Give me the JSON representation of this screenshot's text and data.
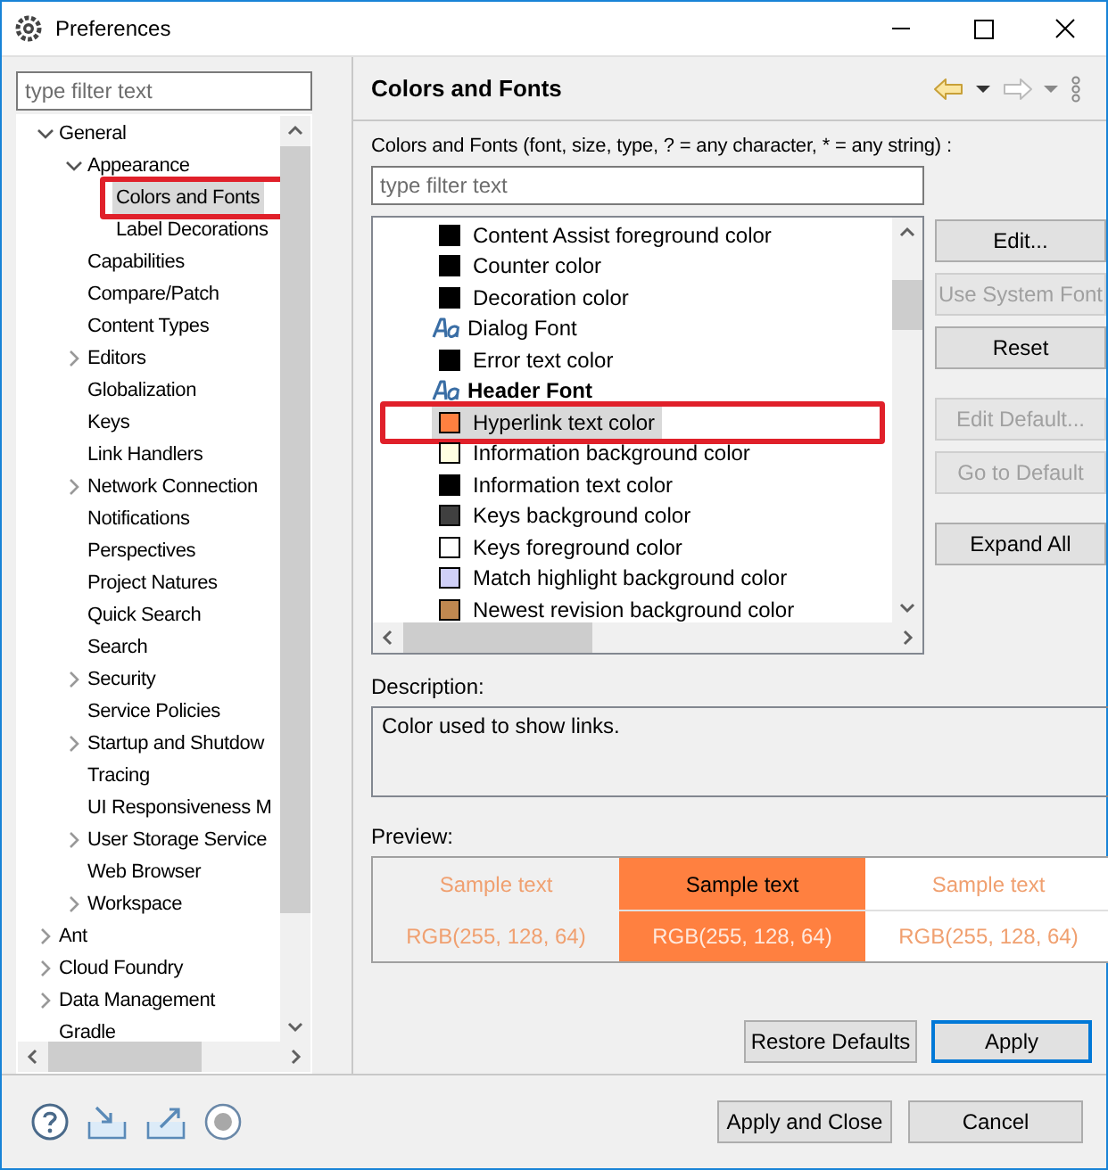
{
  "window": {
    "title": "Preferences"
  },
  "tree": {
    "placeholder": "type filter text",
    "items": [
      {
        "label": "General",
        "selected": false,
        "expanded": true,
        "children": [
          {
            "label": "Appearance",
            "selected": false,
            "expanded": true,
            "children": [
              {
                "label": "Colors and Fonts",
                "selected": true,
                "annotated": true
              },
              {
                "label": "Label Decorations",
                "selected": false
              }
            ]
          },
          {
            "label": "Capabilities",
            "selected": false
          },
          {
            "label": "Compare/Patch",
            "selected": false
          },
          {
            "label": "Content Types",
            "selected": false
          },
          {
            "label": "Editors",
            "selected": false,
            "expanded": false
          },
          {
            "label": "Globalization",
            "selected": false
          },
          {
            "label": "Keys",
            "selected": false
          },
          {
            "label": "Link Handlers",
            "selected": false
          },
          {
            "label": "Network Connection",
            "selected": false,
            "expanded": false
          },
          {
            "label": "Notifications",
            "selected": false
          },
          {
            "label": "Perspectives",
            "selected": false
          },
          {
            "label": "Project Natures",
            "selected": false
          },
          {
            "label": "Quick Search",
            "selected": false
          },
          {
            "label": "Search",
            "selected": false
          },
          {
            "label": "Security",
            "selected": false,
            "expanded": false
          },
          {
            "label": "Service Policies",
            "selected": false
          },
          {
            "label": "Startup and Shutdow",
            "selected": false,
            "expanded": false
          },
          {
            "label": "Tracing",
            "selected": false
          },
          {
            "label": "UI Responsiveness M",
            "selected": false
          },
          {
            "label": "User Storage Service",
            "selected": false,
            "expanded": false
          },
          {
            "label": "Web Browser",
            "selected": false
          },
          {
            "label": "Workspace",
            "selected": false,
            "expanded": false
          }
        ]
      },
      {
        "label": "Ant",
        "selected": false,
        "expanded": false
      },
      {
        "label": "Cloud Foundry",
        "selected": false,
        "expanded": false
      },
      {
        "label": "Data Management",
        "selected": false,
        "expanded": false
      },
      {
        "label": "Gradle",
        "selected": false
      }
    ]
  },
  "page": {
    "title": "Colors and Fonts",
    "filter_label": "Colors and Fonts (font, size, type, ? = any character, * = any string) :",
    "placeholder": "type filter text",
    "items": [
      {
        "kind": "color",
        "label": "Content Assist foreground color",
        "color": "#000000",
        "selected": false
      },
      {
        "kind": "color",
        "label": "Counter color",
        "color": "#000000",
        "selected": false
      },
      {
        "kind": "color",
        "label": "Decoration color",
        "color": "#000000",
        "selected": false
      },
      {
        "kind": "font",
        "label": "Dialog Font",
        "bold": false,
        "selected": false
      },
      {
        "kind": "color",
        "label": "Error text color",
        "color": "#000000",
        "selected": false
      },
      {
        "kind": "font",
        "label": "Header Font",
        "bold": true,
        "selected": false
      },
      {
        "kind": "color",
        "label": "Hyperlink text color",
        "color": "#ff8040",
        "selected": true,
        "annotated": true
      },
      {
        "kind": "color",
        "label": "Information background color",
        "color": "#ffffe1",
        "selected": false
      },
      {
        "kind": "color",
        "label": "Information text color",
        "color": "#000000",
        "selected": false
      },
      {
        "kind": "color",
        "label": "Keys background color",
        "color": "#404040",
        "selected": false
      },
      {
        "kind": "color",
        "label": "Keys foreground color",
        "color": "#ffffff",
        "selected": false
      },
      {
        "kind": "color",
        "label": "Match highlight background color",
        "color": "#d0d0f8",
        "selected": false
      },
      {
        "kind": "color",
        "label": "Newest revision background color",
        "color": "#c08850",
        "selected": false
      }
    ],
    "buttons": [
      {
        "label": "Edit...",
        "disabled": false
      },
      {
        "label": "Use System Font",
        "disabled": true
      },
      {
        "label": "Reset",
        "disabled": false
      },
      {
        "label": "Edit Default...",
        "disabled": true
      },
      {
        "label": "Go to Default",
        "disabled": true
      },
      {
        "label": "Expand All",
        "disabled": false
      }
    ],
    "description_label": "Description:",
    "description": "Color used to show links.",
    "preview_label": "Preview:",
    "preview": {
      "color": "#ff8040",
      "samples": [
        {
          "kind": "on-dialog",
          "text": "Sample text",
          "value": "RGB(255, 128, 64)"
        },
        {
          "kind": "on-color",
          "text": "Sample text",
          "value": "RGB(255, 128, 64)"
        },
        {
          "kind": "on-white",
          "text": "Sample text",
          "value": "RGB(255, 128, 64)"
        }
      ]
    },
    "actions": [
      {
        "label": "Restore Defaults",
        "default": false
      },
      {
        "label": "Apply",
        "default": true
      }
    ]
  },
  "footer": {
    "buttons": [
      {
        "label": "Apply and Close"
      },
      {
        "label": "Cancel"
      }
    ]
  }
}
